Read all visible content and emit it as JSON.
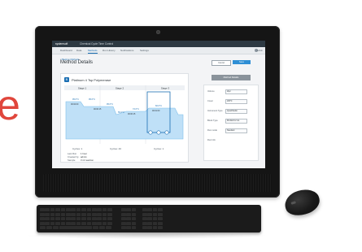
{
  "edge_letter": "e",
  "app": {
    "brand": "systemsoft",
    "title": "Chemical Cycle Time Control"
  },
  "tabs": [
    {
      "label": "Dashboard",
      "active": false
    },
    {
      "label": "Data",
      "active": false
    },
    {
      "label": "Methods",
      "active": true
    },
    {
      "label": "Run History",
      "active": false
    },
    {
      "label": "Notifications",
      "active": false
    },
    {
      "label": "Settings",
      "active": false
    }
  ],
  "user": {
    "label": "Admin"
  },
  "breadcrumb": "< Back to Methods",
  "page_title": "Method Details",
  "actions": {
    "cancel": "Cancel",
    "save": "Save",
    "secondary": "Method Details"
  },
  "card": {
    "title": "Platinum 4 Tsp Polymerase",
    "stages": [
      "Stage 1",
      "Stage 2",
      "Stage 3"
    ],
    "temps": [
      "95.0°C",
      "95.0°C",
      "95.0°C",
      "55.0°C",
      "72.0°C",
      "60.0°C"
    ],
    "times": [
      "00:02:00",
      "00:00:15",
      "00:00:15",
      "00:01:00"
    ],
    "stage_footer": [
      "Cycles: 1",
      "Cycles: 40",
      "Cycles: 1"
    ]
  },
  "meta": [
    {
      "label": "Last Run",
      "value": "1 hour"
    },
    {
      "label": "Created by",
      "value": "admin"
    },
    {
      "label": "Sample",
      "value": "3 ml reaction"
    }
  ],
  "panel": {
    "rows": [
      {
        "label": "Volume",
        "value": "20µl"
      },
      {
        "label": "Cover",
        "value": "105°C"
      },
      {
        "label": "Instrument Type",
        "value": "QuantStudio"
      },
      {
        "label": "Block Type",
        "value": "96-Well 0.2 mL"
      },
      {
        "label": "Run mode",
        "value": "Standard"
      },
      {
        "label": "Run Info",
        "value": ""
      }
    ]
  },
  "colors": {
    "accent": "#1b6fb3",
    "curve_fill": "#bfe0f7",
    "edge_letter": "#e0463c"
  }
}
